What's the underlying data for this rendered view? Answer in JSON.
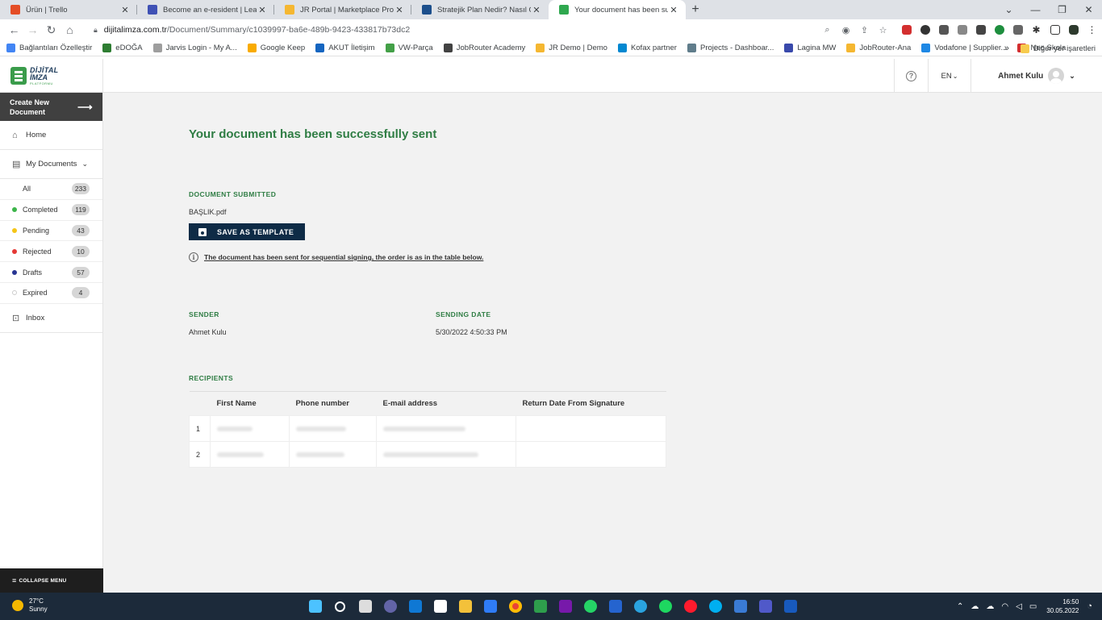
{
  "browser": {
    "tabs": [
      {
        "title": "Ürün | Trello",
        "favicon_color": "#e44d26"
      },
      {
        "title": "Become an e-resident | Learn the",
        "favicon_color": "#3f51b5"
      },
      {
        "title": "JR Portal | Marketplace Product: I",
        "favicon_color": "#f5b731"
      },
      {
        "title": "Stratejik Plan Nedir? Nasıl Oluştu",
        "favicon_color": "#1c4f8c"
      },
      {
        "title": "Your document has been success",
        "favicon_color": "#2fa84f"
      }
    ],
    "url_host": "dijitalimza.com.tr",
    "url_path": "/Document/Summary/c1039997-ba6e-489b-9423-433817b73dc2",
    "bookmarks": [
      {
        "label": "Bağlantıları Özelleştir",
        "color": "#4285f4"
      },
      {
        "label": "eDOĞA",
        "color": "#2e7d32"
      },
      {
        "label": "Jarvis Login - My A...",
        "color": "#9e9e9e"
      },
      {
        "label": "Google Keep",
        "color": "#f9ab00"
      },
      {
        "label": "AKUT İletişim",
        "color": "#1565c0"
      },
      {
        "label": "VW-Parça",
        "color": "#43a047"
      },
      {
        "label": "JobRouter Academy",
        "color": "#424242"
      },
      {
        "label": "JR Demo | Demo",
        "color": "#f5b731"
      },
      {
        "label": "Kofax partner",
        "color": "#0288d1"
      },
      {
        "label": "Projects - Dashboar...",
        "color": "#607d8b"
      },
      {
        "label": "Lagina MW",
        "color": "#3949ab"
      },
      {
        "label": "JobRouter-Ana",
        "color": "#f5b731"
      },
      {
        "label": "Vodafone | Supplier...",
        "color": "#1e88e5"
      },
      {
        "label": "Neo Skola",
        "color": "#d32f2f"
      }
    ],
    "other_bookmarks": "Diğer yer işaretleri"
  },
  "app": {
    "logo": {
      "line1": "DİJİTAL",
      "line2": "İMZA",
      "line3": "PLATFORMU"
    },
    "header": {
      "help_icon": "?",
      "language": "EN",
      "user_name": "Ahmet Kulu"
    },
    "sidebar": {
      "create_label": "Create New Document",
      "home_label": "Home",
      "my_documents_label": "My Documents",
      "filters": [
        {
          "label": "All",
          "count": "233",
          "color": ""
        },
        {
          "label": "Completed",
          "count": "119",
          "color": "#3cb54a"
        },
        {
          "label": "Pending",
          "count": "43",
          "color": "#f5c518"
        },
        {
          "label": "Rejected",
          "count": "10",
          "color": "#e53935"
        },
        {
          "label": "Drafts",
          "count": "57",
          "color": "#283593"
        },
        {
          "label": "Expired",
          "count": "4",
          "color": "#ffffff"
        }
      ],
      "inbox_label": "Inbox",
      "collapse_label": "COLLAPSE MENU"
    },
    "main": {
      "title": "Your document has been successfully sent",
      "document_submitted_label": "DOCUMENT SUBMITTED",
      "file_name": "BAŞLIK.pdf",
      "save_template_label": "SAVE AS TEMPLATE",
      "info_text": "The document has been sent for sequential signing, the order is as in the table below.",
      "sender_label": "SENDER",
      "sender_value": "Ahmet Kulu",
      "sending_date_label": "SENDING DATE",
      "sending_date_value": "5/30/2022 4:50:33 PM",
      "recipients_label": "RECIPIENTS",
      "columns": [
        "",
        "First Name",
        "Phone number",
        "E-mail address",
        "Return Date From Signature"
      ],
      "rows": [
        {
          "order": "1"
        },
        {
          "order": "2"
        }
      ]
    }
  },
  "taskbar": {
    "temperature": "27°C",
    "weather": "Sunny",
    "time": "16:50",
    "date": "30.05.2022"
  }
}
